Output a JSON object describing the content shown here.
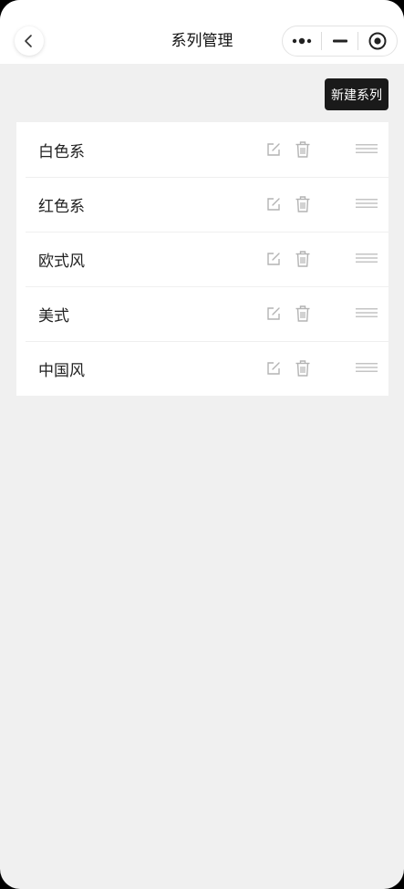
{
  "header": {
    "title": "系列管理"
  },
  "actions": {
    "new_series_label": "新建系列"
  },
  "series": [
    {
      "label": "白色系"
    },
    {
      "label": "红色系"
    },
    {
      "label": "欧式风"
    },
    {
      "label": "美式"
    },
    {
      "label": "中国风"
    }
  ],
  "icons": {
    "back": "chevron-left-icon",
    "more": "more-dots-icon",
    "minimize": "minimize-icon",
    "close": "target-circle-icon",
    "edit": "edit-icon",
    "delete": "trash-icon",
    "drag": "drag-handle-icon"
  },
  "colors": {
    "primary_button": "#1a1a1a",
    "background": "#f0f0f0",
    "icon_gray": "#b3b3b3"
  }
}
